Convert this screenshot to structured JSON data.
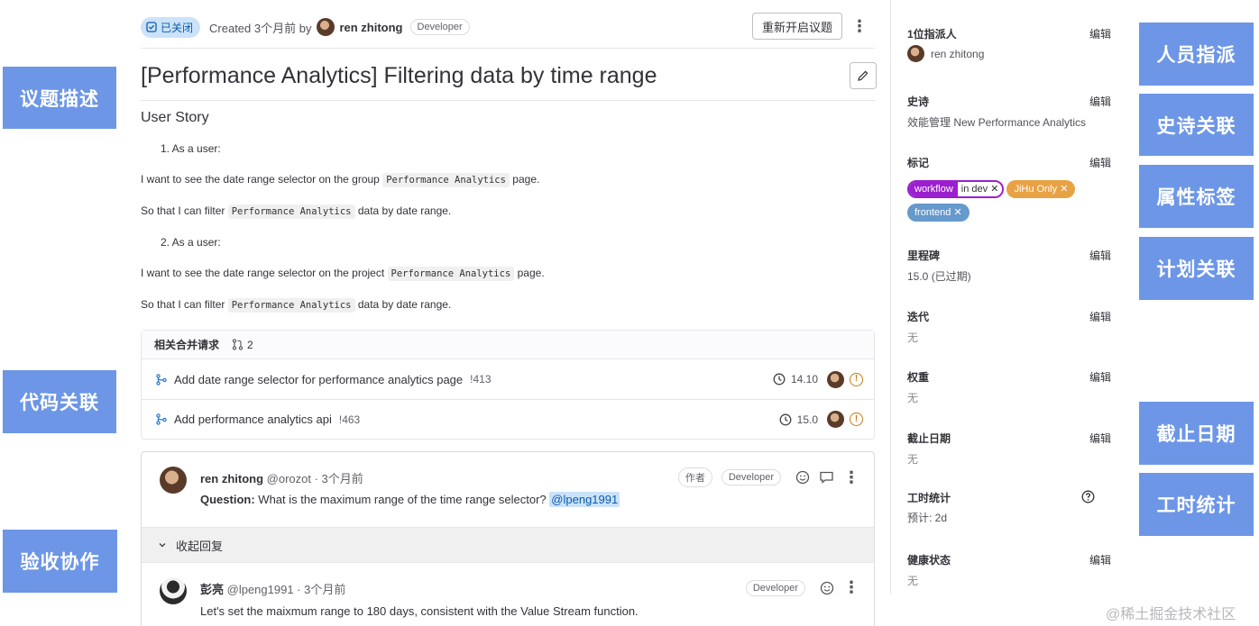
{
  "callouts": {
    "issue_desc": "议题描述",
    "code_link": "代码关联",
    "acceptance": "验收协作",
    "assignee": "人员指派",
    "epic_link": "史诗关联",
    "attr_labels": "属性标签",
    "plan_link": "计划关联",
    "due_date": "截止日期",
    "time_tracking": "工时统计"
  },
  "header": {
    "status": "已关闭",
    "created": "Created 3个月前 by",
    "author": "ren zhitong",
    "role": "Developer",
    "reopen_label": "重新开启议题"
  },
  "issue": {
    "title": "[Performance Analytics] Filtering data by time range",
    "story_heading": "User Story",
    "item1": "1. As a user:",
    "item1_want_pre": "I want to see the date range selector on the group",
    "item1_want_code": "Performance Analytics",
    "item1_want_post": "page.",
    "item1_so_pre": "So that I can filter",
    "item1_so_code": "Performance Analytics",
    "item1_so_post": "data by date range.",
    "item2": "2. As a user:",
    "item2_want_pre": "I want to see the date range selector on the project",
    "item2_want_code": "Performance Analytics",
    "item2_want_post": "page.",
    "item2_so_pre": "So that I can filter",
    "item2_so_code": "Performance Analytics",
    "item2_so_post": "data by date range."
  },
  "related_mrs": {
    "heading": "相关合并请求",
    "count": "2",
    "items": [
      {
        "title": "Add date range selector for performance analytics page",
        "ref": "!413",
        "milestone": "14.10"
      },
      {
        "title": "Add performance analytics api",
        "ref": "!463",
        "milestone": "15.0"
      }
    ]
  },
  "discussion": {
    "note1": {
      "author": "ren zhitong",
      "meta": "@orozot · 3个月前",
      "badge_author": "作者",
      "badge_role": "Developer",
      "body_bold": "Question:",
      "body": "What is the maximum range of the time range selector?",
      "mention": "@lpeng1991"
    },
    "collapse_label": "收起回复",
    "note2": {
      "author": "彭亮",
      "meta": "@lpeng1991 · 3个月前",
      "badge_role": "Developer",
      "body": "Let's set the maixmum range to 180 days, consistent with the Value Stream function."
    }
  },
  "sidebar": {
    "edit_label": "编辑",
    "assignee_label": "1位指派人",
    "assignee_name": "ren zhitong",
    "epic_label": "史诗",
    "epic_value": "效能管理 New Performance Analytics",
    "labels_label": "标记",
    "labels": [
      {
        "scope": "workflow",
        "value": "in dev",
        "color": "#9b1fcf"
      },
      {
        "text": "JiHu Only",
        "color": "#e8a244"
      },
      {
        "text": "frontend",
        "color": "#6699cc"
      }
    ],
    "milestone_label": "里程碑",
    "milestone_value": "15.0 (已过期)",
    "iteration_label": "迭代",
    "iteration_value": "无",
    "weight_label": "权重",
    "weight_value": "无",
    "due_label": "截止日期",
    "due_value": "无",
    "time_label": "工时统计",
    "time_value": "预计: 2d",
    "health_label": "健康状态",
    "health_value": "无"
  },
  "watermark": "@稀土掘金技术社区",
  "colors": {
    "callout": "#6d96e6",
    "closed_badge_bg": "#cbe2f9",
    "scoped_label": "#9b1fcf",
    "jihu_label": "#e8a244",
    "frontend_label": "#6699cc"
  }
}
